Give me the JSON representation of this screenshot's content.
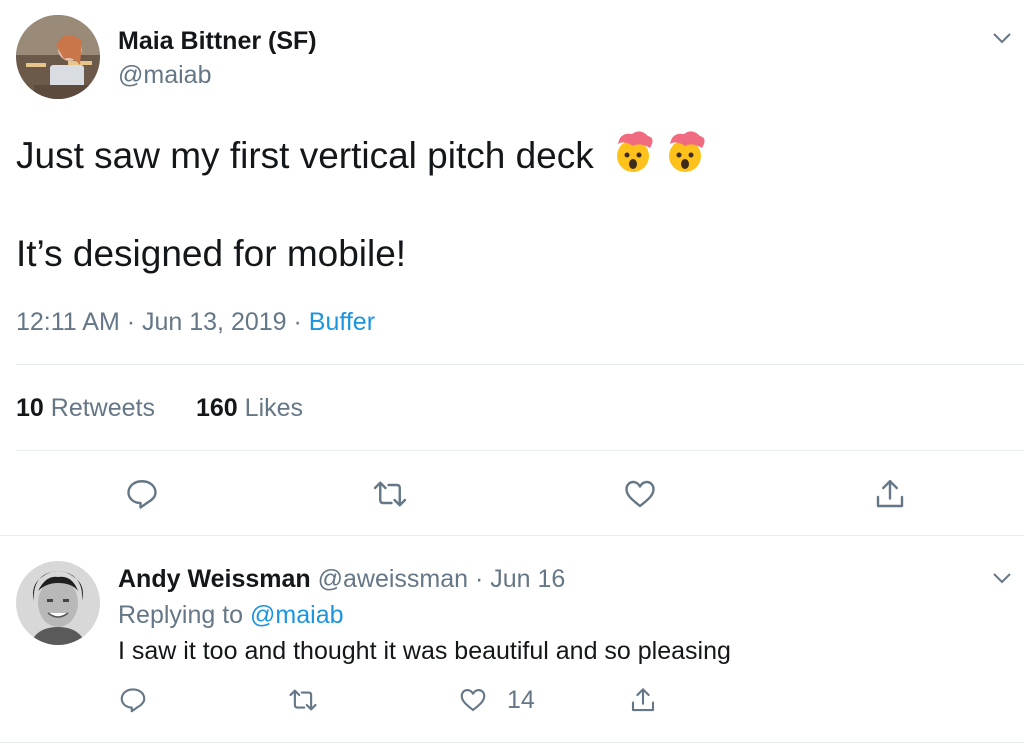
{
  "main_tweet": {
    "author_name": "Maia Bittner (SF)",
    "author_handle": "@maiab",
    "line1": "Just saw my first vertical pitch deck",
    "line2": "It’s designed for mobile!",
    "emoji": [
      "exploding-head",
      "exploding-head"
    ],
    "time_date": "12:11 AM · Jun 13, 2019 · ",
    "source": "Buffer",
    "retweets_count": "10",
    "retweets_label": "Retweets",
    "likes_count": "160",
    "likes_label": "Likes"
  },
  "reply": {
    "author_name": "Andy Weissman",
    "author_handle": "@aweissman",
    "date": "· Jun 16",
    "replying_prefix": "Replying to ",
    "replying_handle": "@maiab",
    "text": "I saw it too and thought it was beautiful and so pleasing",
    "likes_count": "14"
  },
  "colors": {
    "text": "#14171a",
    "secondary": "#657786",
    "link": "#1b95e0",
    "divider": "#e6ecf0"
  }
}
